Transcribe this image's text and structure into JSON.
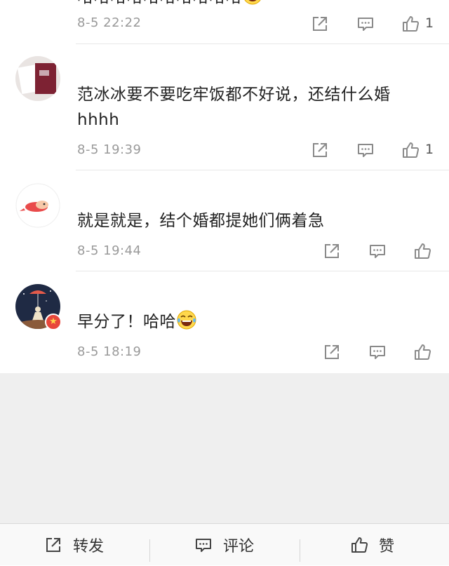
{
  "comments": [
    {
      "username": "",
      "text": "哈哈哈哈哈哈哈哈哈哈",
      "time": "8-5 22:22",
      "like_count": "1"
    },
    {
      "username": "",
      "text": "范冰冰要不要吃牢饭都不好说，还结什么婚hhhh",
      "time": "8-5 19:39",
      "like_count": "1"
    },
    {
      "username": "",
      "text": "就是就是，结个婚都提她们俩着急",
      "time": "8-5 19:44",
      "like_count": ""
    },
    {
      "username": "",
      "text": "早分了！哈哈",
      "time": "8-5 18:19",
      "like_count": ""
    }
  ],
  "bottom_bar": {
    "repost_label": "转发",
    "comment_label": "评论",
    "like_label": "赞"
  },
  "icons": {
    "share": "share-icon",
    "comment": "comment-icon",
    "like": "thumbs-up-icon",
    "emoji": "laughing-tears-emoji"
  },
  "colors": {
    "text": "#222222",
    "meta": "#9a9a9a",
    "divider": "#e8e8e8",
    "background_gray": "#efefef",
    "vip_badge": "#e8463b"
  }
}
